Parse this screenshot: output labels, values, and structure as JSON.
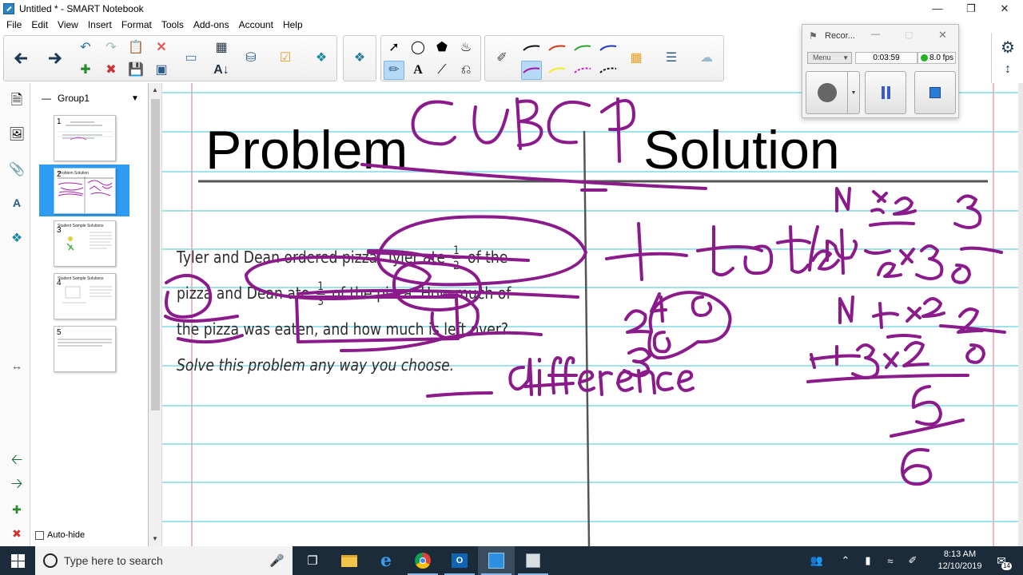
{
  "window": {
    "title": "Untitled * - SMART Notebook"
  },
  "menu": [
    "File",
    "Edit",
    "View",
    "Insert",
    "Format",
    "Tools",
    "Add-ons",
    "Account",
    "Help"
  ],
  "sorter": {
    "group_label": "Group1",
    "pages": [
      {
        "num": "1",
        "title": ""
      },
      {
        "num": "2",
        "title": "Problem  Solution"
      },
      {
        "num": "3",
        "title": "Student Sample Solutions"
      },
      {
        "num": "4",
        "title": "Student Sample Solutions"
      },
      {
        "num": "5",
        "title": ""
      }
    ],
    "autohide_label": "Auto-hide"
  },
  "page": {
    "problem_heading": "Problem",
    "solution_heading": "Solution",
    "problem_text": {
      "p1": "Tyler and Dean ordered pizza. Tyler ate ",
      "f1n": "1",
      "f1d": "2",
      "p2": " of the pizza and Dean ate ",
      "f2n": "1",
      "f2d": "3",
      "p3": " of the pizza. How much of the pizza was eaten, and how much is left over?",
      "p4": " Solve this problem any way you choose."
    }
  },
  "recorder": {
    "title": "Recor...",
    "menu_label": "Menu",
    "time": "0:03:59",
    "fps": "8.0 fps"
  },
  "taskbar": {
    "search_placeholder": "Type here to search",
    "time": "8:13 AM",
    "date": "12/10/2019",
    "notifications": "14"
  },
  "colors": {
    "ink": "#8b1a8b",
    "accent": "#2e9cf2",
    "taskbar": "#1b2b3a",
    "rule_line": "#9ee3ee",
    "margin_line": "#e6a4a4"
  }
}
